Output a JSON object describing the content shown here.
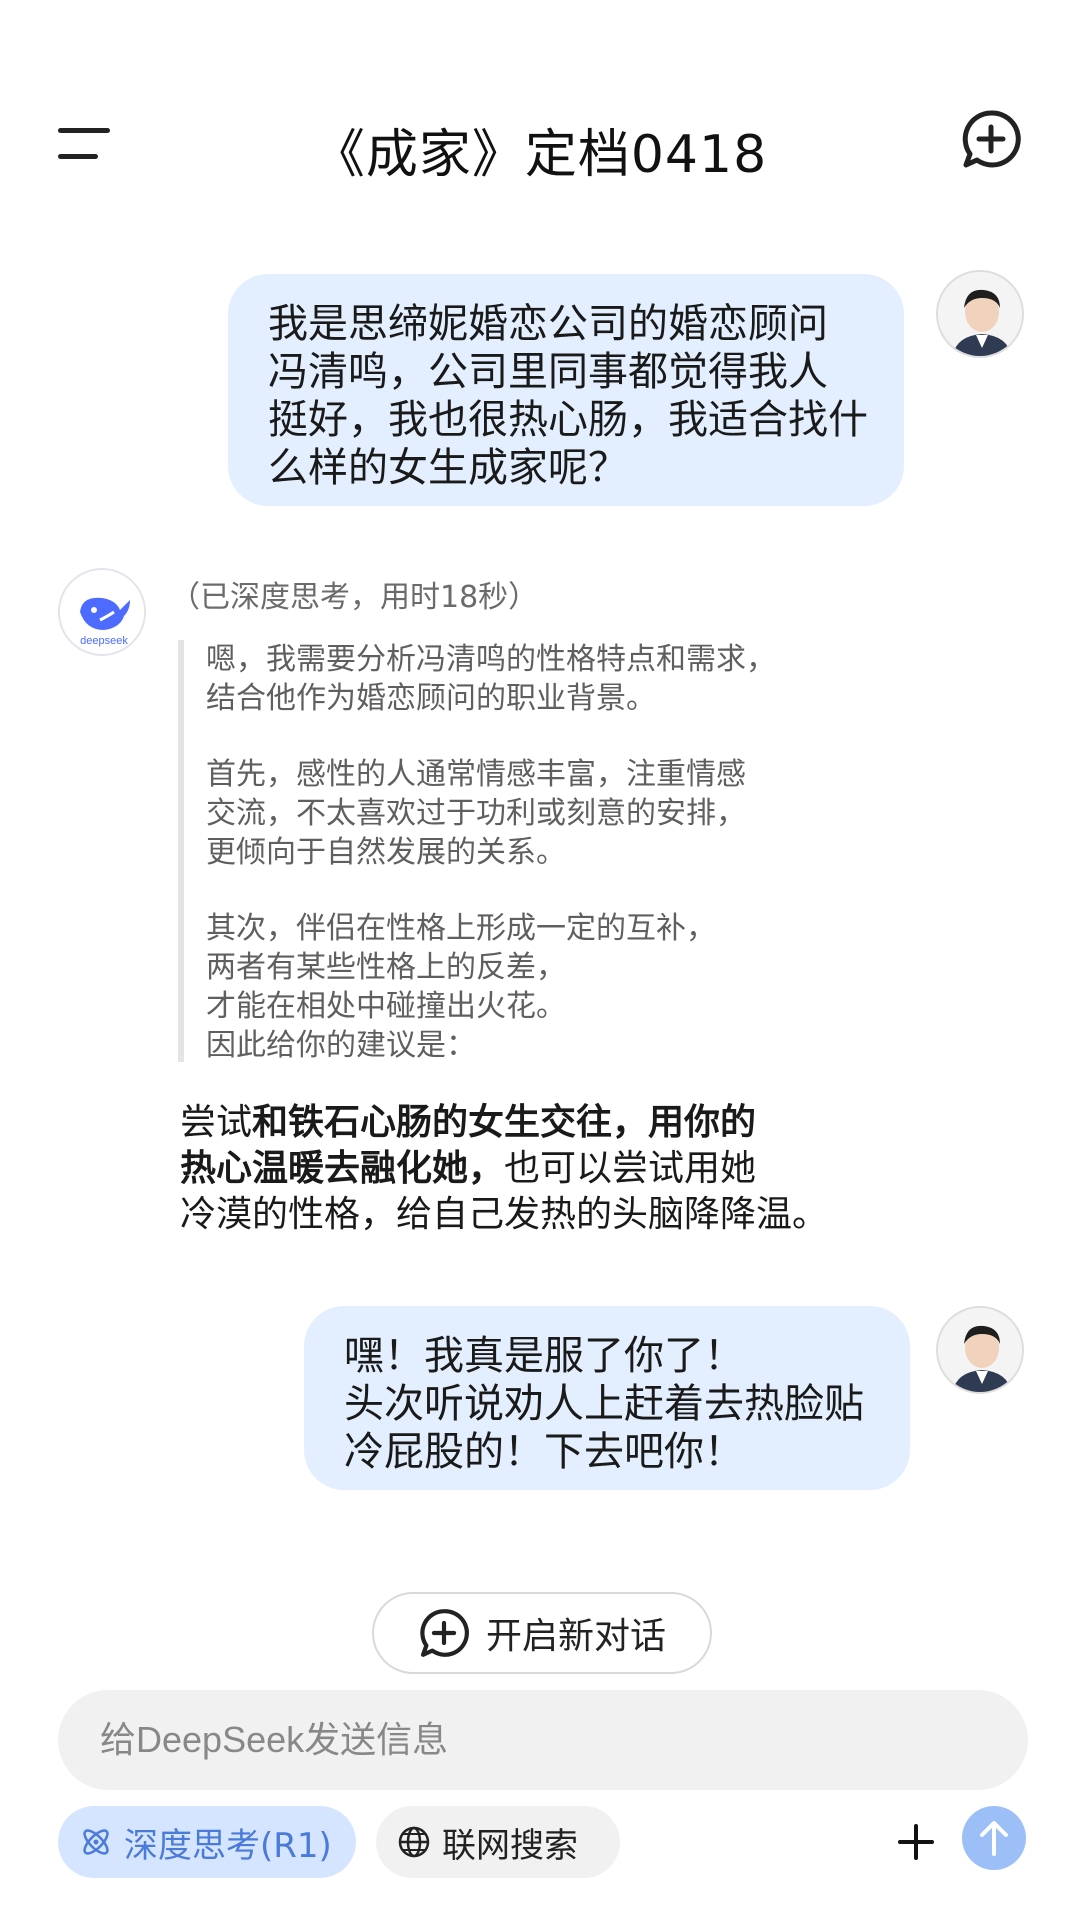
{
  "header": {
    "title": "《成家》定档0418",
    "menu_icon": "menu-icon",
    "new_chat_icon": "chat-plus-icon"
  },
  "messages": [
    {
      "role": "user",
      "avatar": "user-avatar",
      "lines": [
        "我是思缔妮婚恋公司的婚恋顾问",
        "冯清鸣，公司里同事都觉得我人",
        "挺好，我也很热心肠，我适合找什",
        "么样的女生成家呢？"
      ]
    },
    {
      "role": "assistant",
      "avatar": "deepseek-logo",
      "logo_text": "deepseek",
      "think_label": "（已深度思考，用时18秒）",
      "think_paragraphs": [
        [
          "嗯，我需要分析冯清鸣的性格特点和需求，",
          "结合他作为婚恋顾问的职业背景。"
        ],
        [
          "首先，感性的人通常情感丰富，注重情感",
          "交流，不太喜欢过于功利或刻意的安排，",
          "更倾向于自然发展的关系。"
        ],
        [
          "其次，伴侣在性格上形成一定的互补，",
          "两者有某些性格上的反差，",
          "才能在相处中碰撞出火花。",
          "因此给你的建议是："
        ]
      ],
      "answer": {
        "line1_normal": "尝试",
        "line1_bold": "和铁石心肠的女生交往，用你的",
        "line2_bold": "热心温暖去融化她，",
        "line2_normal": "也可以尝试用她",
        "line3": "冷漠的性格，给自己发热的头脑降降温。"
      }
    },
    {
      "role": "user",
      "avatar": "user-avatar",
      "lines": [
        "嘿！我真是服了你了！",
        "头次听说劝人上赶着去热脸贴",
        "冷屁股的！下去吧你！"
      ]
    }
  ],
  "new_chat_button": {
    "label": "开启新对话",
    "icon": "chat-plus-icon"
  },
  "input": {
    "placeholder": "给DeepSeek发送信息",
    "value": ""
  },
  "toolbar": {
    "deep_think": {
      "label": "深度思考(R1)",
      "icon": "atom-icon",
      "active": true
    },
    "web_search": {
      "label": "联网搜索",
      "icon": "globe-icon",
      "active": false
    },
    "attach_icon": "plus-icon",
    "send_icon": "arrow-up-icon"
  },
  "colors": {
    "user_bubble": "#e3efff",
    "accent_blue": "#4d6bfe",
    "send_button": "#9dbff7",
    "chip_active_bg": "#d6e5ff",
    "chip_active_text": "#4a7bd9"
  }
}
